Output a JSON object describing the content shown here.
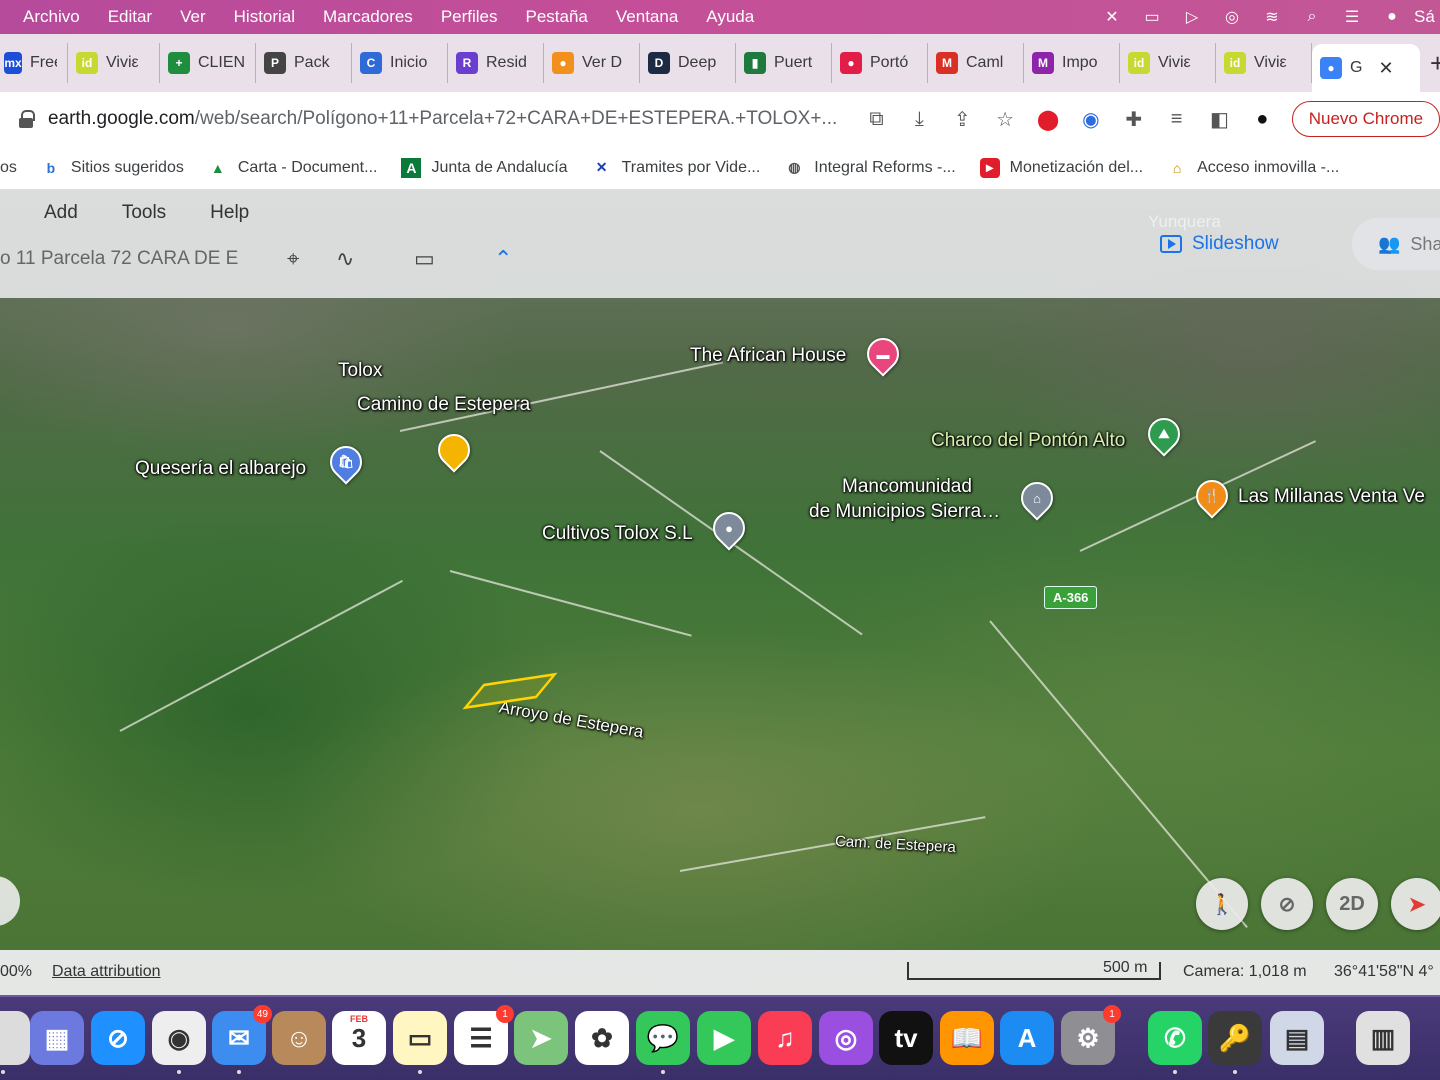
{
  "menubar": {
    "items": [
      "Archivo",
      "Editar",
      "Ver",
      "Historial",
      "Marcadores",
      "Perfiles",
      "Pestaña",
      "Ventana",
      "Ayuda"
    ],
    "right_truncated": "Sá"
  },
  "tabs": [
    {
      "title": "Free",
      "icon": "mx-icon",
      "color": "#1d4ed8",
      "glyph": "mx"
    },
    {
      "title": "Viviε",
      "icon": "idealista-icon",
      "color": "#c7d930",
      "glyph": "id"
    },
    {
      "title": "CLIEN",
      "icon": "plus-green-icon",
      "color": "#1e8e3e",
      "glyph": "+"
    },
    {
      "title": "Pack",
      "icon": "pack-icon",
      "color": "#444444",
      "glyph": "P"
    },
    {
      "title": "Inicio",
      "icon": "circle-blue-icon",
      "color": "#2f6bd8",
      "glyph": "C"
    },
    {
      "title": "Resid",
      "icon": "purple-icon",
      "color": "#6a3fd0",
      "glyph": "R"
    },
    {
      "title": "Ver D",
      "icon": "orange-icon",
      "color": "#f2901d",
      "glyph": "●"
    },
    {
      "title": "Deep",
      "icon": "deep-icon",
      "color": "#1c2a44",
      "glyph": "D"
    },
    {
      "title": "Puert",
      "icon": "book-icon",
      "color": "#1e7a3e",
      "glyph": "▮"
    },
    {
      "title": "Portó",
      "icon": "red-icon",
      "color": "#e11d48",
      "glyph": "●"
    },
    {
      "title": "Caml",
      "icon": "gmail-icon",
      "color": "#d93025",
      "glyph": "M"
    },
    {
      "title": "Impo",
      "icon": "gmail-icon",
      "color": "#8e24aa",
      "glyph": "M"
    },
    {
      "title": "Viviε",
      "icon": "idealista-icon",
      "color": "#c7d930",
      "glyph": "id"
    },
    {
      "title": "Viviε",
      "icon": "idealista-icon",
      "color": "#c7d930",
      "glyph": "id"
    },
    {
      "title": "G",
      "icon": "earth-icon",
      "color": "#3b82f6",
      "glyph": "●",
      "active": true
    }
  ],
  "address": {
    "domain": "earth.google.com",
    "path": "/web/search/Polígono+11+Parcela+72+CARA+DE+ESTEPERA.+TOLOX+...",
    "nuevo_chrome": "Nuevo Chrome"
  },
  "bookmarks": [
    {
      "label": "os",
      "icon": ""
    },
    {
      "label": "Sitios sugeridos",
      "icon": "bing-icon"
    },
    {
      "label": "Carta - Document...",
      "icon": "drive-icon"
    },
    {
      "label": "Junta de Andalucía",
      "icon": "andalucia-icon"
    },
    {
      "label": "Tramites por Vide...",
      "icon": "tramites-icon"
    },
    {
      "label": "Integral Reforms -...",
      "icon": "globe-icon"
    },
    {
      "label": "Monetización del...",
      "icon": "youtube-icon"
    },
    {
      "label": "Acceso inmovilla -...",
      "icon": "inmovilla-icon"
    }
  ],
  "earth": {
    "menu": [
      "Add",
      "Tools",
      "Help"
    ],
    "place_title": "o 11 Parcela 72 CARA DE E",
    "slideshow": "Slideshow",
    "share": "Sha",
    "faint_top_labels": [
      "Yunquera"
    ],
    "labels": {
      "tolox": "Tolox",
      "camino": "Camino de Estepera",
      "queseria": "Quesería el albarejo",
      "african": "The African House",
      "charco": "Charco del Pontón Alto",
      "mancomunidad_1": "Mancomunidad",
      "mancomunidad_2": "de Municipios Sierra…",
      "millanas": "Las Millanas Venta Ve",
      "cultivos": "Cultivos Tolox S.L",
      "arroyo": "Arroyo de Estepera",
      "cam": "Cam. de Estepera",
      "road": "A-366"
    },
    "controls": {
      "two_d": "2D"
    },
    "footer": {
      "zoom": "00%",
      "attribution": "Data attribution",
      "scale": "500 m",
      "camera": "Camera: 1,018 m",
      "coords": "36°41'58\"N 4°"
    },
    "colors": {
      "parcel": "#ffd400",
      "link": "#1a73e8"
    }
  },
  "dock": [
    {
      "name": "finder",
      "color": "#dcdcdc",
      "glyph": ""
    },
    {
      "name": "launchpad",
      "color": "#6c7ae0",
      "glyph": "▦"
    },
    {
      "name": "safari",
      "color": "#1e90ff",
      "glyph": "⊘"
    },
    {
      "name": "chrome",
      "color": "#eeeeee",
      "glyph": "◉"
    },
    {
      "name": "mail",
      "color": "#3d8cf0",
      "glyph": "✉",
      "badge": "49"
    },
    {
      "name": "contacts",
      "color": "#b8895a",
      "glyph": "☺"
    },
    {
      "name": "calendar",
      "color": "#ffffff",
      "glyph": "3",
      "month": "FEB"
    },
    {
      "name": "notes",
      "color": "#fff6c2",
      "glyph": "▭"
    },
    {
      "name": "reminders",
      "color": "#ffffff",
      "glyph": "☰",
      "badge": "1"
    },
    {
      "name": "maps",
      "color": "#7cc47c",
      "glyph": "➤"
    },
    {
      "name": "photos",
      "color": "#ffffff",
      "glyph": "✿"
    },
    {
      "name": "messages",
      "color": "#34c759",
      "glyph": "💬"
    },
    {
      "name": "facetime",
      "color": "#34c759",
      "glyph": "▶"
    },
    {
      "name": "music",
      "color": "#fa3c55",
      "glyph": "♫"
    },
    {
      "name": "podcasts",
      "color": "#9b4fe0",
      "glyph": "◎"
    },
    {
      "name": "tv",
      "color": "#111111",
      "glyph": "tv"
    },
    {
      "name": "books",
      "color": "#ff9500",
      "glyph": "📖"
    },
    {
      "name": "appstore",
      "color": "#1c8cf2",
      "glyph": "A"
    },
    {
      "name": "settings",
      "color": "#8e8e93",
      "glyph": "⚙",
      "badge": "1"
    },
    {
      "name": "whatsapp",
      "color": "#25d366",
      "glyph": "✆"
    },
    {
      "name": "keychain",
      "color": "#3a3a3a",
      "glyph": "🔑"
    },
    {
      "name": "preview",
      "color": "#d0d8e8",
      "glyph": "▤"
    },
    {
      "name": "screenshot",
      "color": "#e0e0e0",
      "glyph": "▥"
    }
  ]
}
